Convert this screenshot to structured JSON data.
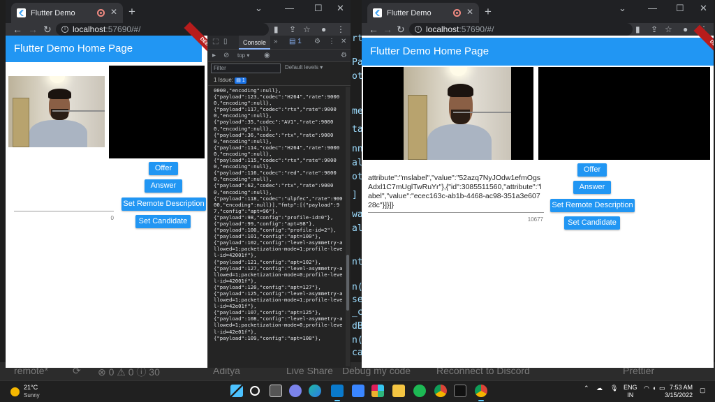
{
  "background_editor": {
    "code_fragments": [
      "rt",
      "Pa",
      "ot",
      "me",
      "tal",
      "nn",
      "alt",
      "ot",
      "] a",
      "wa",
      "al",
      "nt",
      "n(",
      "se",
      "_c",
      "dB",
      "n(",
      "ca"
    ],
    "status_bar": {
      "branch": "remote*",
      "problems": "⊗ 0 ⚠ 0 ⓘ 30",
      "user": "Aditya",
      "live_share": "Live Share",
      "debug": "Debug my code",
      "discord": "Reconnect to Discord",
      "prettier": "Prettier"
    }
  },
  "left_window": {
    "tab_title": "Flutter Demo",
    "url_host": "localhost",
    "url_rest": ":57690/#/",
    "app_title": "Flutter Demo Home Page",
    "debug_banner": "DEBUG",
    "buttons": {
      "offer": "Offer",
      "answer": "Answer",
      "set_remote": "Set Remote Description",
      "set_candidate": "Set Candidate"
    },
    "sdp_value": "",
    "char_count": "0",
    "devtools": {
      "tab_console": "Console",
      "context": "top",
      "filter_placeholder": "Filter",
      "levels": "Default levels",
      "issues": "1 Issue:",
      "issues_count": "1",
      "issues_badge": "1",
      "console_text": "0000,\"encoding\":null},\n{\"payload\":123,\"codec\":\"H264\",\"rate\":90000,\"encoding\":null},\n{\"payload\":117,\"codec\":\"rtx\",\"rate\":90000,\"encoding\":null},\n{\"payload\":35,\"codec\":\"AV1\",\"rate\":90000,\"encoding\":null},\n{\"payload\":36,\"codec\":\"rtx\",\"rate\":90000,\"encoding\":null},\n{\"payload\":114,\"codec\":\"H264\",\"rate\":90000,\"encoding\":null},\n{\"payload\":115,\"codec\":\"rtx\",\"rate\":90000,\"encoding\":null},\n{\"payload\":116,\"codec\":\"red\",\"rate\":90000,\"encoding\":null},\n{\"payload\":62,\"codec\":\"rtx\",\"rate\":90000,\"encoding\":null},\n{\"payload\":118,\"codec\":\"ulpfec\",\"rate\":90000,\"encoding\":null}],\"fmtp\":[{\"payload\":97,\"config\":\"apt=96\"},\n{\"payload\":98,\"config\":\"profile-id=0\"},\n{\"payload\":99,\"config\":\"apt=98\"},\n{\"payload\":100,\"config\":\"profile-id=2\"},\n{\"payload\":101,\"config\":\"apt=100\"},\n{\"payload\":102,\"config\":\"level-asymmetry-allowed=1;packetization-mode=1;profile-level-id=42001f\"},\n{\"payload\":121,\"config\":\"apt=102\"},\n{\"payload\":127,\"config\":\"level-asymmetry-allowed=1;packetization-mode=0;profile-level-id=42001f\"},\n{\"payload\":120,\"config\":\"apt=127\"},\n{\"payload\":125,\"config\":\"level-asymmetry-allowed=1;packetization-mode=1;profile-level-id=42e01f\"},\n{\"payload\":107,\"config\":\"apt=125\"},\n{\"payload\":108,\"config\":\"level-asymmetry-allowed=1;packetization-mode=0;profile-level-id=42e01f\"},\n{\"payload\":109,\"config\":\"apt=108\"},"
    }
  },
  "right_window": {
    "tab_title": "Flutter Demo",
    "url_host": "localhost",
    "url_rest": ":57690/#/",
    "app_title": "Flutter Demo Home Page",
    "debug_banner": "DEBUG",
    "buttons": {
      "offer": "Offer",
      "answer": "Answer",
      "set_remote": "Set Remote Description",
      "set_candidate": "Set Candidate"
    },
    "sdp_value": "attribute\":\"mslabel\",\"value\":\"52azq7NyJOdw1efmOgsAdxl1C7mUglTwRuYr\"},{\"id\":3085511560,\"attribute\":\"label\",\"value\":\"ecec163c-ab1b-4468-ac98-351a3e60728c\"}]}]}",
    "char_count": "10677"
  },
  "taskbar": {
    "temperature": "21°C",
    "weather": "Sunny",
    "lang_top": "ENG",
    "lang_bottom": "IN",
    "time": "7:53 AM",
    "date": "3/15/2022"
  },
  "colors": {
    "flutter_blue": "#2196f3",
    "chrome_dark": "#202124",
    "debug_red": "#b71c1c"
  }
}
